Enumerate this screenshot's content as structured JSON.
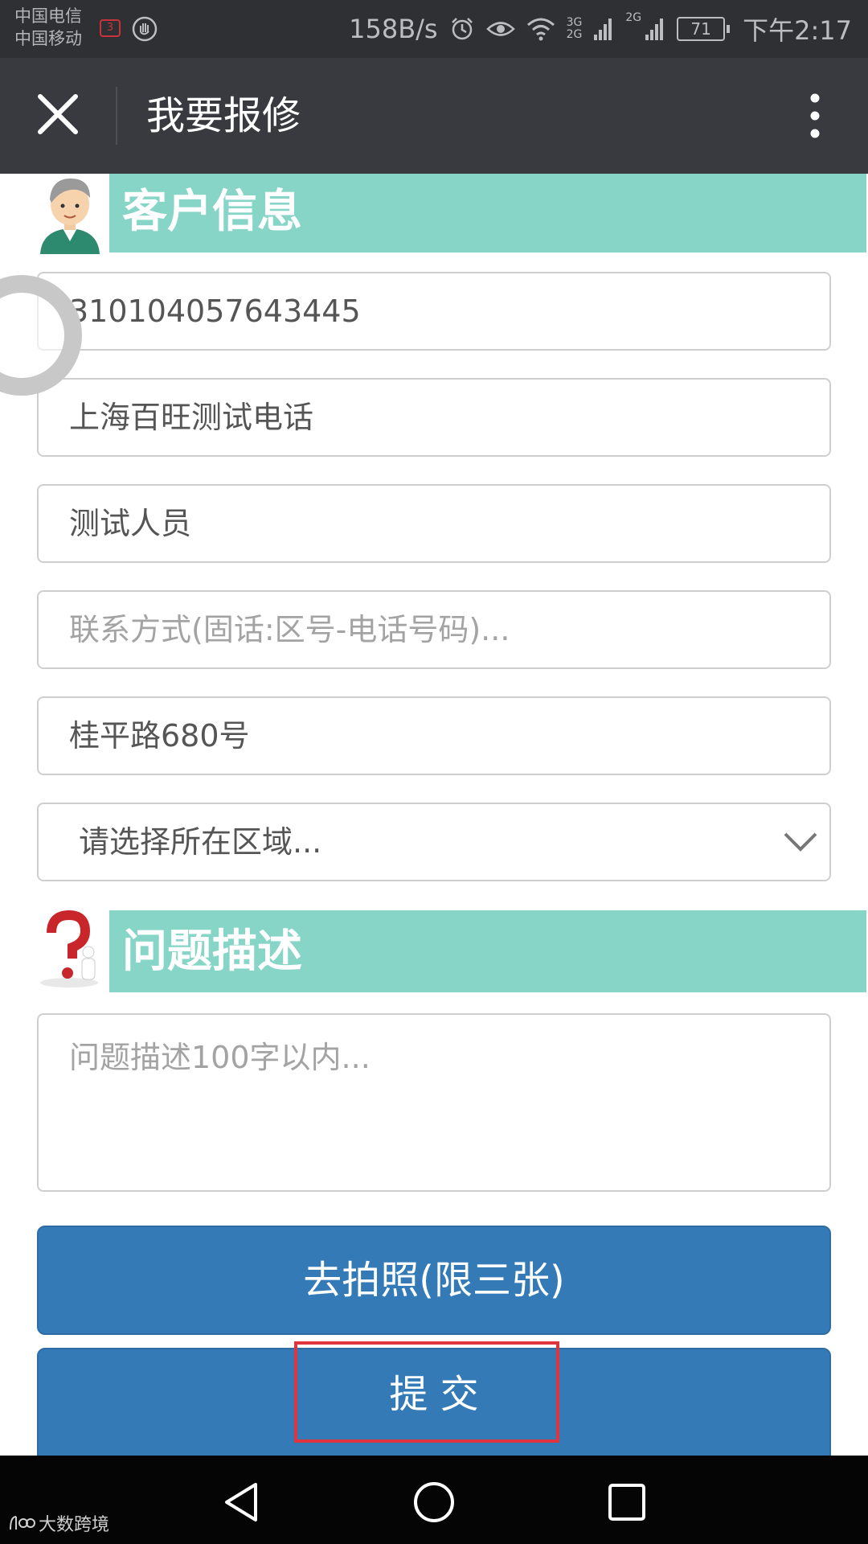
{
  "status_bar": {
    "carrier_1": "中国电信",
    "carrier_2": "中国移动",
    "sim_badge": "3",
    "speed": "158B/s",
    "network_1": "3G",
    "network_2": "2G",
    "battery": "71",
    "time": "下午2:17"
  },
  "header": {
    "title": "我要报修"
  },
  "customer_section": {
    "title": "客户信息",
    "fields": {
      "account": "310104057643445",
      "company": "上海百旺测试电话",
      "contact_person": "测试人员",
      "phone_placeholder": "联系方式(固话:区号-电话号码)...",
      "address": "桂平路680号",
      "region_select": "请选择所在区域..."
    }
  },
  "problem_section": {
    "title": "问题描述",
    "description_placeholder": "问题描述100字以内..."
  },
  "buttons": {
    "photo": "去拍照(限三张)",
    "submit": "提 交"
  },
  "watermark": "大数跨境",
  "colors": {
    "section_band": "#86d5c7",
    "button_blue": "#337ab7",
    "highlight_red": "#e0343e",
    "titlebar": "#393a3f"
  }
}
